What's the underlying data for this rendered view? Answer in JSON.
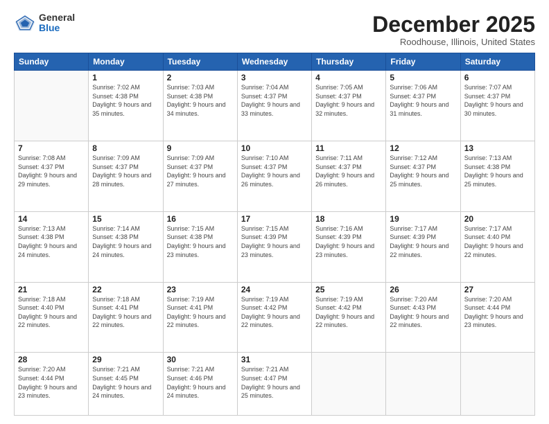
{
  "header": {
    "logo_general": "General",
    "logo_blue": "Blue",
    "month_title": "December 2025",
    "location": "Roodhouse, Illinois, United States"
  },
  "weekdays": [
    "Sunday",
    "Monday",
    "Tuesday",
    "Wednesday",
    "Thursday",
    "Friday",
    "Saturday"
  ],
  "weeks": [
    [
      {
        "day": "",
        "sunrise": "",
        "sunset": "",
        "daylight": ""
      },
      {
        "day": "1",
        "sunrise": "7:02 AM",
        "sunset": "4:38 PM",
        "daylight": "9 hours and 35 minutes."
      },
      {
        "day": "2",
        "sunrise": "7:03 AM",
        "sunset": "4:38 PM",
        "daylight": "9 hours and 34 minutes."
      },
      {
        "day": "3",
        "sunrise": "7:04 AM",
        "sunset": "4:37 PM",
        "daylight": "9 hours and 33 minutes."
      },
      {
        "day": "4",
        "sunrise": "7:05 AM",
        "sunset": "4:37 PM",
        "daylight": "9 hours and 32 minutes."
      },
      {
        "day": "5",
        "sunrise": "7:06 AM",
        "sunset": "4:37 PM",
        "daylight": "9 hours and 31 minutes."
      },
      {
        "day": "6",
        "sunrise": "7:07 AM",
        "sunset": "4:37 PM",
        "daylight": "9 hours and 30 minutes."
      }
    ],
    [
      {
        "day": "7",
        "sunrise": "7:08 AM",
        "sunset": "4:37 PM",
        "daylight": "9 hours and 29 minutes."
      },
      {
        "day": "8",
        "sunrise": "7:09 AM",
        "sunset": "4:37 PM",
        "daylight": "9 hours and 28 minutes."
      },
      {
        "day": "9",
        "sunrise": "7:09 AM",
        "sunset": "4:37 PM",
        "daylight": "9 hours and 27 minutes."
      },
      {
        "day": "10",
        "sunrise": "7:10 AM",
        "sunset": "4:37 PM",
        "daylight": "9 hours and 26 minutes."
      },
      {
        "day": "11",
        "sunrise": "7:11 AM",
        "sunset": "4:37 PM",
        "daylight": "9 hours and 26 minutes."
      },
      {
        "day": "12",
        "sunrise": "7:12 AM",
        "sunset": "4:37 PM",
        "daylight": "9 hours and 25 minutes."
      },
      {
        "day": "13",
        "sunrise": "7:13 AM",
        "sunset": "4:38 PM",
        "daylight": "9 hours and 25 minutes."
      }
    ],
    [
      {
        "day": "14",
        "sunrise": "7:13 AM",
        "sunset": "4:38 PM",
        "daylight": "9 hours and 24 minutes."
      },
      {
        "day": "15",
        "sunrise": "7:14 AM",
        "sunset": "4:38 PM",
        "daylight": "9 hours and 24 minutes."
      },
      {
        "day": "16",
        "sunrise": "7:15 AM",
        "sunset": "4:38 PM",
        "daylight": "9 hours and 23 minutes."
      },
      {
        "day": "17",
        "sunrise": "7:15 AM",
        "sunset": "4:39 PM",
        "daylight": "9 hours and 23 minutes."
      },
      {
        "day": "18",
        "sunrise": "7:16 AM",
        "sunset": "4:39 PM",
        "daylight": "9 hours and 23 minutes."
      },
      {
        "day": "19",
        "sunrise": "7:17 AM",
        "sunset": "4:39 PM",
        "daylight": "9 hours and 22 minutes."
      },
      {
        "day": "20",
        "sunrise": "7:17 AM",
        "sunset": "4:40 PM",
        "daylight": "9 hours and 22 minutes."
      }
    ],
    [
      {
        "day": "21",
        "sunrise": "7:18 AM",
        "sunset": "4:40 PM",
        "daylight": "9 hours and 22 minutes."
      },
      {
        "day": "22",
        "sunrise": "7:18 AM",
        "sunset": "4:41 PM",
        "daylight": "9 hours and 22 minutes."
      },
      {
        "day": "23",
        "sunrise": "7:19 AM",
        "sunset": "4:41 PM",
        "daylight": "9 hours and 22 minutes."
      },
      {
        "day": "24",
        "sunrise": "7:19 AM",
        "sunset": "4:42 PM",
        "daylight": "9 hours and 22 minutes."
      },
      {
        "day": "25",
        "sunrise": "7:19 AM",
        "sunset": "4:42 PM",
        "daylight": "9 hours and 22 minutes."
      },
      {
        "day": "26",
        "sunrise": "7:20 AM",
        "sunset": "4:43 PM",
        "daylight": "9 hours and 22 minutes."
      },
      {
        "day": "27",
        "sunrise": "7:20 AM",
        "sunset": "4:44 PM",
        "daylight": "9 hours and 23 minutes."
      }
    ],
    [
      {
        "day": "28",
        "sunrise": "7:20 AM",
        "sunset": "4:44 PM",
        "daylight": "9 hours and 23 minutes."
      },
      {
        "day": "29",
        "sunrise": "7:21 AM",
        "sunset": "4:45 PM",
        "daylight": "9 hours and 24 minutes."
      },
      {
        "day": "30",
        "sunrise": "7:21 AM",
        "sunset": "4:46 PM",
        "daylight": "9 hours and 24 minutes."
      },
      {
        "day": "31",
        "sunrise": "7:21 AM",
        "sunset": "4:47 PM",
        "daylight": "9 hours and 25 minutes."
      },
      {
        "day": "",
        "sunrise": "",
        "sunset": "",
        "daylight": ""
      },
      {
        "day": "",
        "sunrise": "",
        "sunset": "",
        "daylight": ""
      },
      {
        "day": "",
        "sunrise": "",
        "sunset": "",
        "daylight": ""
      }
    ]
  ],
  "labels": {
    "sunrise_prefix": "Sunrise: ",
    "sunset_prefix": "Sunset: ",
    "daylight_prefix": "Daylight: "
  }
}
